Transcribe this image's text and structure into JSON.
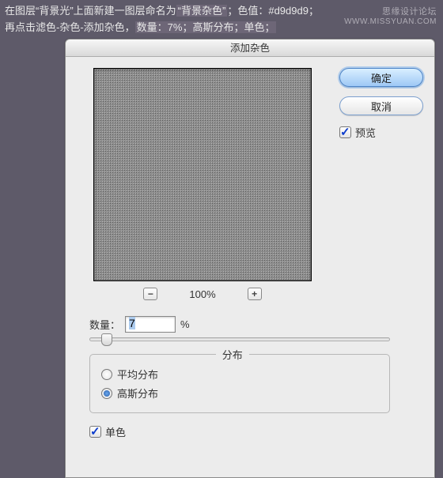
{
  "watermark": {
    "line1": "思缘设计论坛",
    "line2": "WWW.MISSYUAN.COM"
  },
  "caption": {
    "line1a": "在图层“背景光”上面新建一图层命名为",
    "line1b": "“背景杂色”",
    "line1c": "；色值：#d9d9d9；",
    "line2a": "再点击滤色-杂色-添加杂色，",
    "line2b": "数量：7%；高斯分布；单色；"
  },
  "dialog": {
    "title": "添加杂色",
    "buttons": {
      "ok": "确定",
      "cancel": "取消"
    },
    "preview_checkbox": {
      "label": "预览",
      "checked": true
    },
    "zoom": {
      "minus": "⊟",
      "percent": "100%",
      "plus": "⊞"
    },
    "amount": {
      "label": "数量：",
      "value": "7",
      "unit": "%"
    },
    "distribution": {
      "legend": "分布",
      "options": [
        {
          "label": "平均分布",
          "checked": false
        },
        {
          "label": "高斯分布",
          "checked": true
        }
      ]
    },
    "monochrome": {
      "label": "单色",
      "checked": true
    }
  }
}
